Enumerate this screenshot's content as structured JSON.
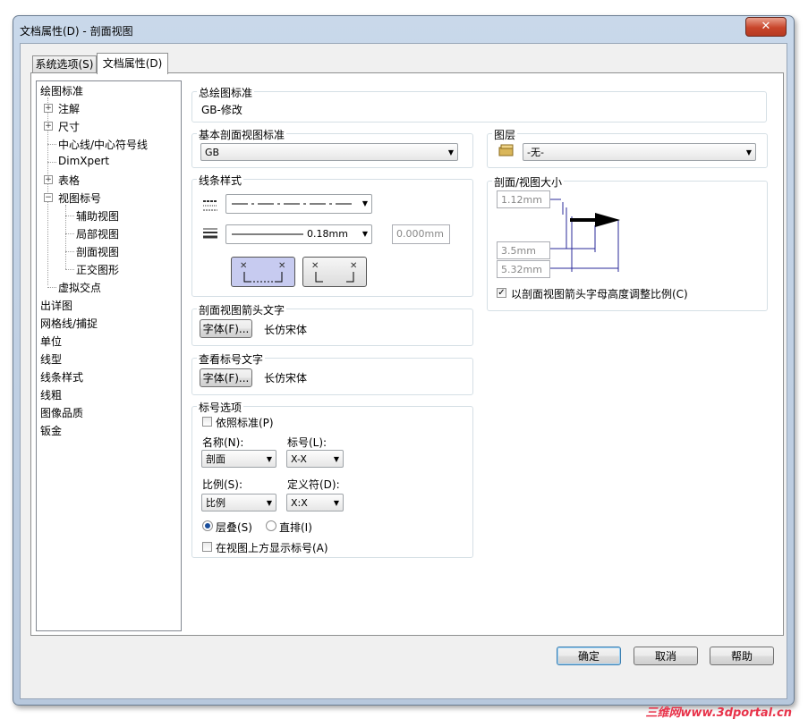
{
  "window": {
    "title": "文档属性(D) - 剖面视图",
    "close_symbol": "✕"
  },
  "tabs": [
    {
      "label": "系统选项(S)"
    },
    {
      "label": "文档属性(D)"
    }
  ],
  "tree": {
    "items": [
      {
        "label": "绘图标准"
      },
      {
        "label": "注解"
      },
      {
        "label": "尺寸"
      },
      {
        "label": "中心线/中心符号线"
      },
      {
        "label": "DimXpert"
      },
      {
        "label": "表格"
      },
      {
        "label": "视图标号"
      },
      {
        "label": "辅助视图"
      },
      {
        "label": "局部视图"
      },
      {
        "label": "剖面视图"
      },
      {
        "label": "正交图形"
      },
      {
        "label": "虚拟交点"
      },
      {
        "label": "出详图"
      },
      {
        "label": "网格线/捕捉"
      },
      {
        "label": "单位"
      },
      {
        "label": "线型"
      },
      {
        "label": "线条样式"
      },
      {
        "label": "线粗"
      },
      {
        "label": "图像品质"
      },
      {
        "label": "钣金"
      }
    ]
  },
  "overall_standard": {
    "label": "总绘图标准",
    "value": "GB-修改"
  },
  "base_standard": {
    "label": "基本剖面视图标准",
    "value": "GB"
  },
  "layer": {
    "label": "图层",
    "value": "-无-"
  },
  "line_style": {
    "label": "线条样式",
    "thickness_value": "0.18mm",
    "custom_thickness": "0.000mm"
  },
  "section_size": {
    "label": "剖面/视图大小",
    "val1": "1.12mm",
    "val2": "3.5mm",
    "val3": "5.32mm",
    "scale_checkbox": "以剖面视图箭头字母高度调整比例(C)",
    "scale_checked": "✓"
  },
  "arrow_text": {
    "label": "剖面视图箭头文字",
    "font_button": "字体(F)...",
    "font_name": "长仿宋体"
  },
  "view_label_text": {
    "label": "查看标号文字",
    "font_button": "字体(F)...",
    "font_name": "长仿宋体"
  },
  "label_options": {
    "label": "标号选项",
    "per_standard": "依照标准(P)",
    "name_label": "名称(N):",
    "name_value": "剖面",
    "label_label": "标号(L):",
    "label_value": "X-X",
    "scale_label": "比例(S):",
    "scale_value": "比例",
    "delimiter_label": "定义符(D):",
    "delimiter_value": "X:X",
    "stacked": "层叠(S)",
    "inline": "直排(I)",
    "show_above": "在视图上方显示标号(A)"
  },
  "buttons": {
    "ok": "确定",
    "cancel": "取消",
    "help": "帮助"
  },
  "watermark": "三维网www.3dportal.cn"
}
